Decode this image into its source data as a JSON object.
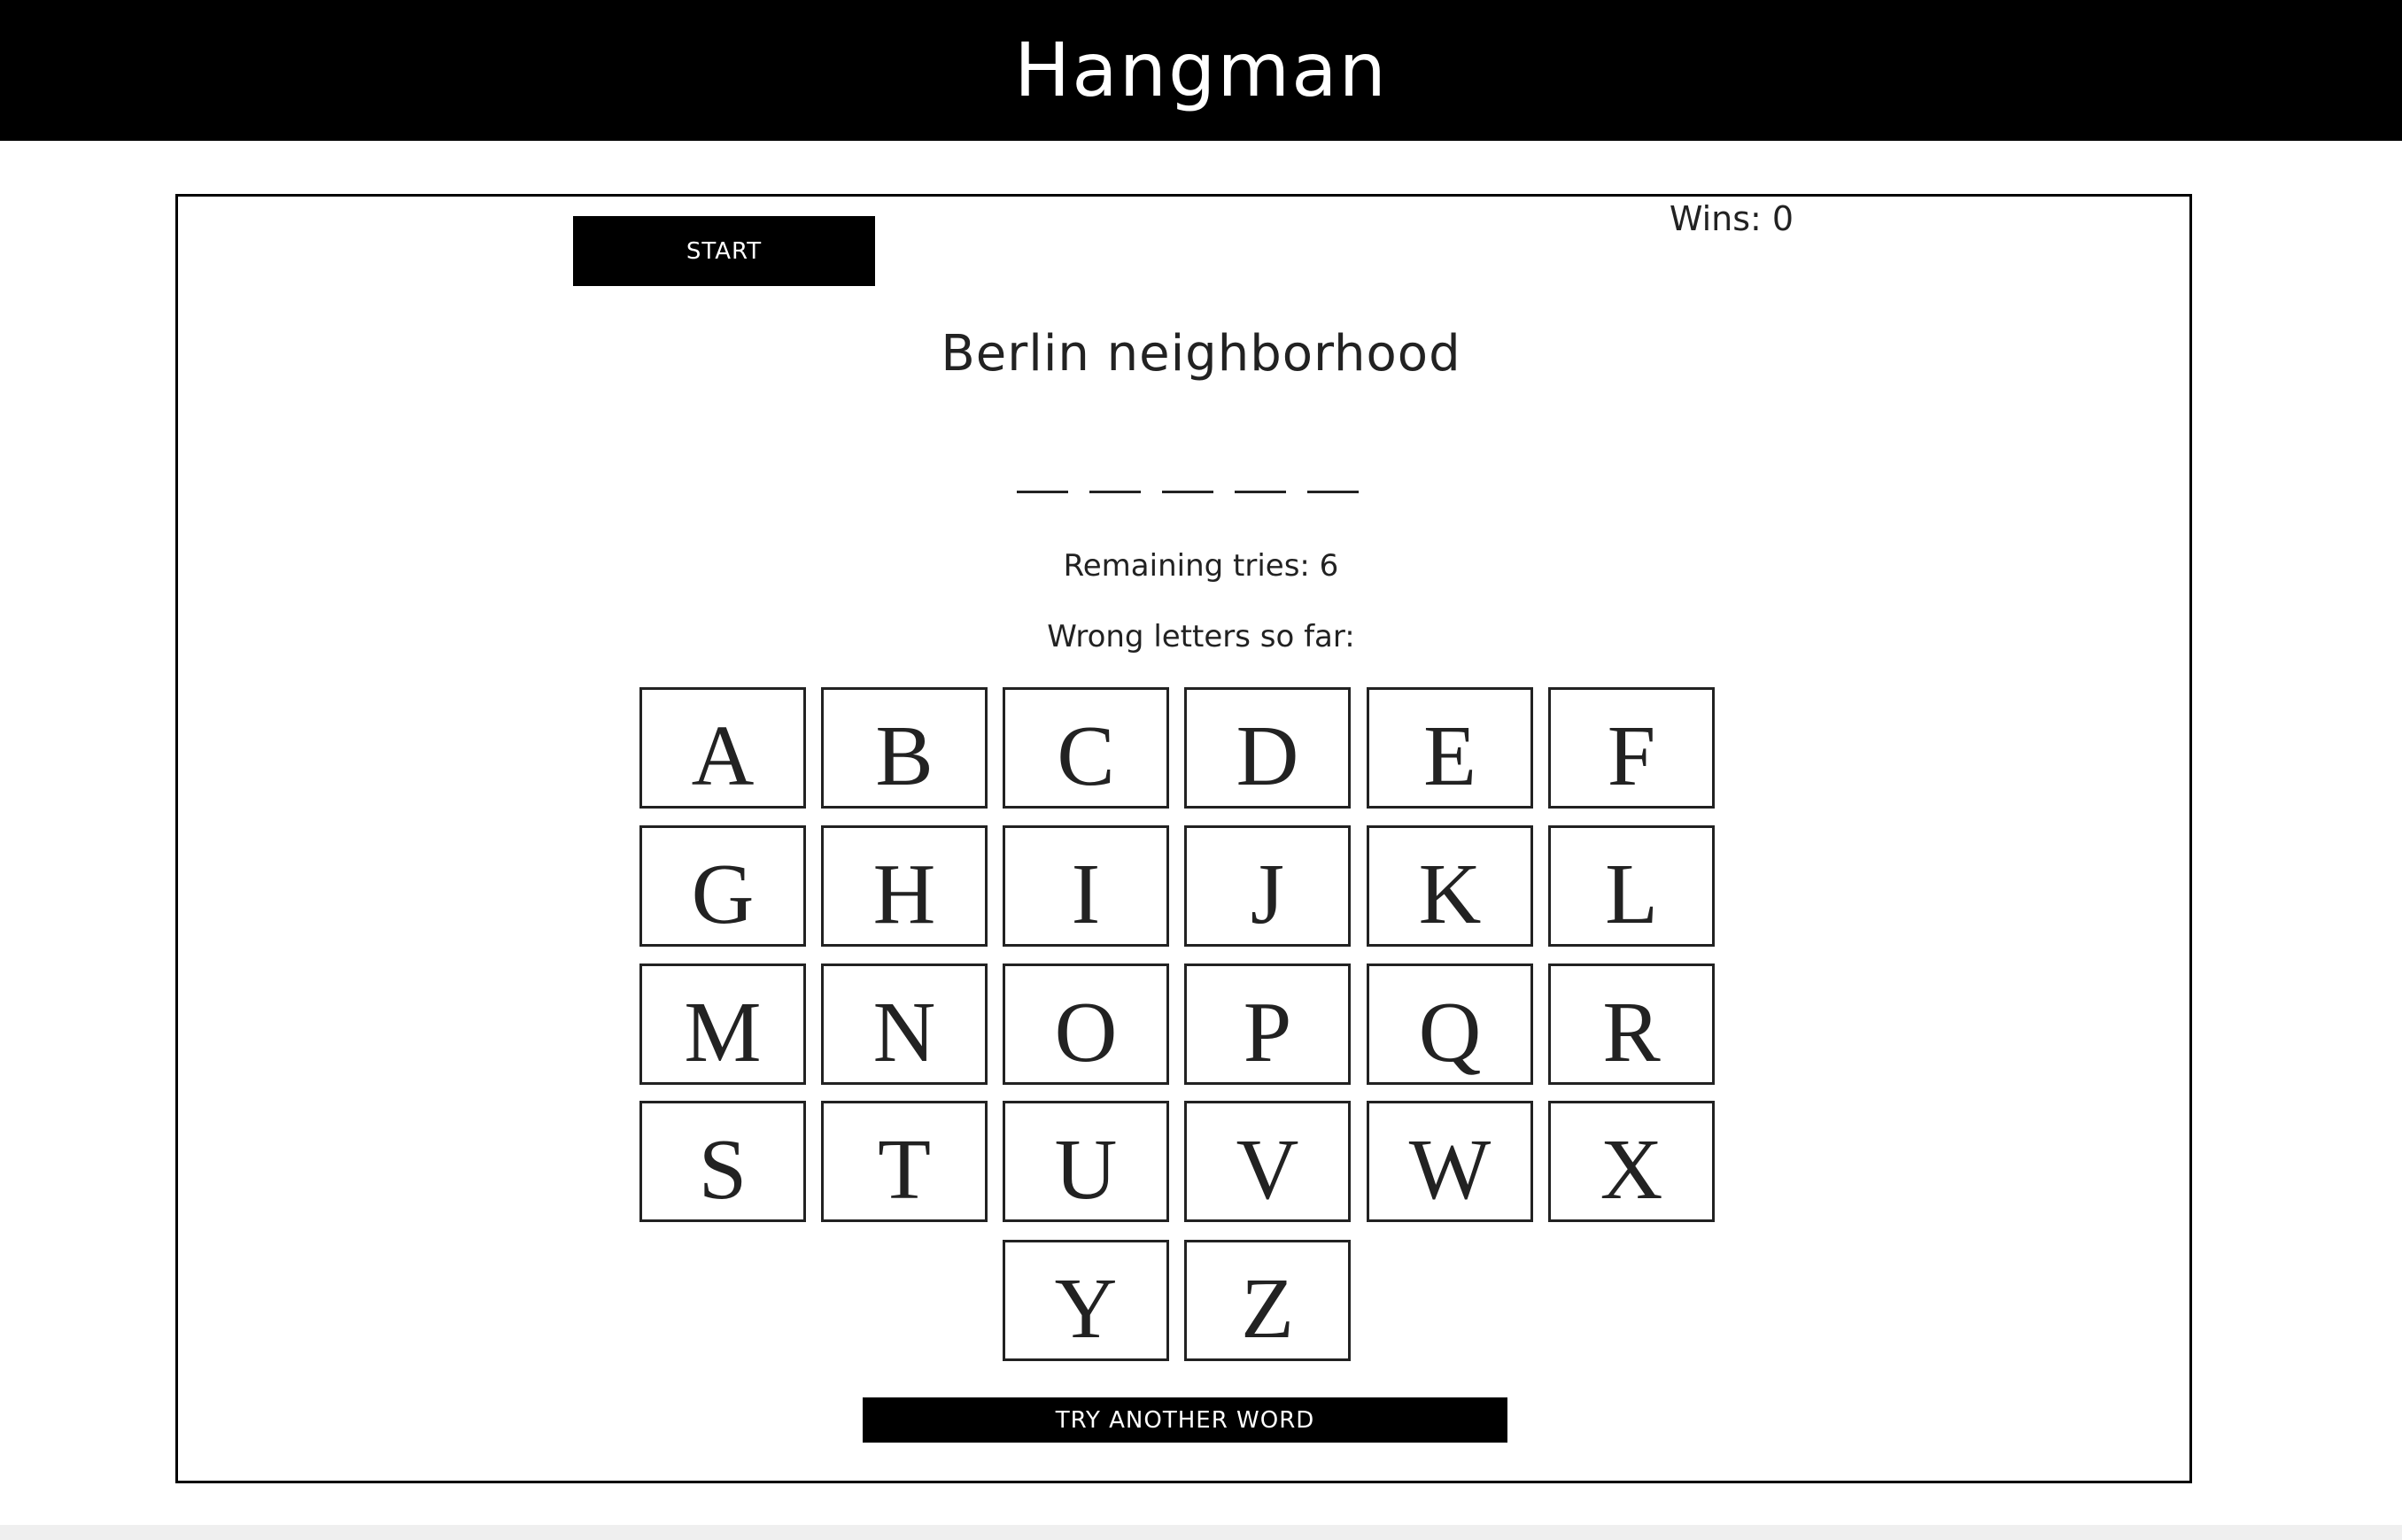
{
  "header": {
    "title": "Hangman"
  },
  "game": {
    "start_label": "START",
    "wins_text": "Wins: 0",
    "category": "Berlin neighborhood",
    "word_length": 5,
    "remaining_tries_text": "Remaining tries: 6",
    "wrong_letters_text": "Wrong letters so far:",
    "try_another_label": "TRY ANOTHER WORD"
  },
  "keyboard": {
    "letters": [
      "A",
      "B",
      "C",
      "D",
      "E",
      "F",
      "G",
      "H",
      "I",
      "J",
      "K",
      "L",
      "M",
      "N",
      "O",
      "P",
      "Q",
      "R",
      "S",
      "T",
      "U",
      "V",
      "W",
      "X",
      "Y",
      "Z"
    ]
  },
  "colors": {
    "header_bg": "#000000",
    "button_bg": "#000000",
    "button_text": "#ffffff",
    "text": "#222222"
  }
}
